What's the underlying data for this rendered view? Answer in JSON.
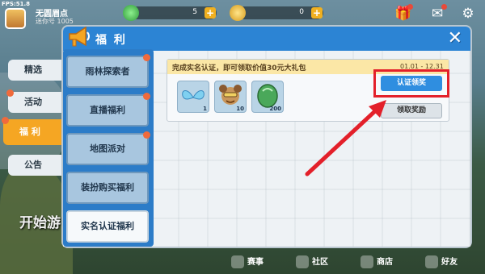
{
  "hud": {
    "fps": "FPS:51.8",
    "player_name": "无圆眉点",
    "player_id": "迷你号 1005",
    "coins": "5",
    "beans": "0",
    "plus": "+"
  },
  "categories": [
    {
      "label": "精选"
    },
    {
      "label": "活动"
    },
    {
      "label": "福 利"
    },
    {
      "label": "公告"
    }
  ],
  "dialog": {
    "title": "福 利",
    "close_label": "✕"
  },
  "menu": [
    {
      "label": "雨林探索者"
    },
    {
      "label": "直播福利"
    },
    {
      "label": "地图派对"
    },
    {
      "label": "装扮购买福利"
    },
    {
      "label": "实名认证福利"
    }
  ],
  "event": {
    "title": "完成实名认证，即可领取价值30元大礼包",
    "date": "01.01 - 12.31",
    "items": [
      {
        "icon": "wings-icon",
        "count": "1"
      },
      {
        "icon": "character-icon",
        "count": "10"
      },
      {
        "icon": "gem-icon",
        "count": "200"
      }
    ],
    "verify_button": "认证领奖",
    "claim_button": "领取奖励"
  },
  "background": {
    "start_text": "开始游"
  },
  "bottom_nav": [
    {
      "label": "赛事"
    },
    {
      "label": "社区"
    },
    {
      "label": "商店"
    },
    {
      "label": "好友"
    }
  ],
  "colors": {
    "header_blue": "#2c84d4",
    "active_tab": "#f5a623",
    "highlight_red": "#e3202a"
  }
}
